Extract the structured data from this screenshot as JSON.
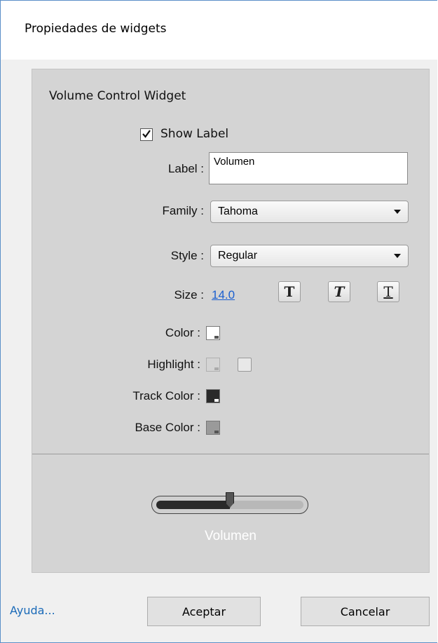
{
  "window": {
    "title": "Propiedades de widgets"
  },
  "widget": {
    "title": "Volume Control Widget",
    "show_label": {
      "label": "Show Label",
      "checked": true
    },
    "label_field": {
      "caption": "Label :",
      "value": "Volumen"
    },
    "family": {
      "caption": "Family :",
      "value": "Tahoma"
    },
    "style": {
      "caption": "Style :",
      "value": "Regular"
    },
    "size": {
      "caption": "Size :",
      "value": "14.0"
    },
    "format_buttons": [
      "T",
      "T",
      "T"
    ],
    "color": {
      "caption": "Color :",
      "value": "#ffffff"
    },
    "highlight": {
      "caption": "Highlight :",
      "value": "#d4d4d4"
    },
    "track_color": {
      "caption": "Track Color :",
      "value": "#2a2a2a"
    },
    "base_color": {
      "caption": "Base Color :",
      "value": "#9a9a9a"
    }
  },
  "preview": {
    "caption": "Volumen",
    "level": 0.5
  },
  "footer": {
    "help": "Ayuda...",
    "ok": "Aceptar",
    "cancel": "Cancelar"
  }
}
